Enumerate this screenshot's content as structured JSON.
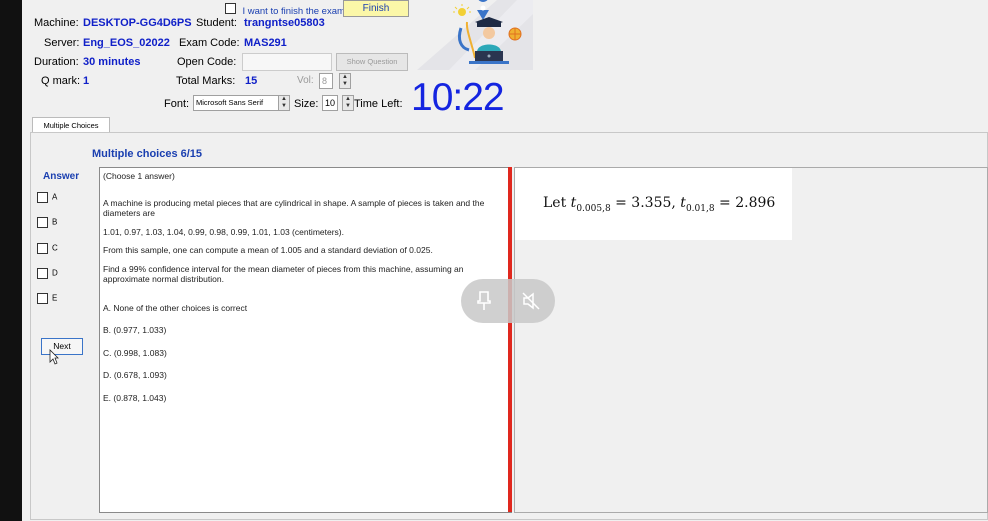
{
  "header": {
    "finish_checkbox_label": "I want to finish the exam.",
    "finish_button": "Finish",
    "machine_label": "Machine:",
    "machine_value": "DESKTOP-GG4D6PS",
    "student_label": "Student:",
    "student_value": "trangntse05803",
    "server_label": "Server:",
    "server_value": "Eng_EOS_02022",
    "exam_code_label": "Exam Code:",
    "exam_code_value": "MAS291",
    "duration_label": "Duration:",
    "duration_value": "30 minutes",
    "open_code_label": "Open Code:",
    "open_code_value": "",
    "show_question_button": "Show Question",
    "qmark_label": "Q mark:",
    "qmark_value": "1",
    "total_marks_label": "Total Marks:",
    "total_marks_value": "15",
    "vol_label": "Vol:",
    "vol_value": "8",
    "font_label": "Font:",
    "font_value": "Microsoft Sans Serif",
    "size_label": "Size:",
    "size_value": "10",
    "time_left_label": "Time Left:",
    "timer": "10:22"
  },
  "tabs": [
    "Multiple Choices"
  ],
  "question": {
    "title": "Multiple choices 6/15",
    "answer_heading": "Answer",
    "answer_options": [
      "A",
      "B",
      "C",
      "D",
      "E"
    ],
    "next_button": "Next",
    "instruction": "(Choose 1 answer)",
    "paragraphs": [
      "A machine is producing metal pieces that are cylindrical in shape. A sample of pieces is taken and the diameters are",
      "1.01, 0.97, 1.03, 1.04, 0.99, 0.98, 0.99, 1.01,  1.03 (centimeters).",
      "From this sample, one can compute a mean of 1.005 and a standard deviation of 0.025.",
      "Find a 99% confidence interval for the mean diameter of pieces from this machine, assuming an approximate normal distribution."
    ],
    "choices": [
      "A.  None of the other choices is correct",
      "B.  (0.977, 1.033)",
      "C.  (0.998, 1.083)",
      "D.  (0.678, 1.093)",
      "E.  (0.878, 1.043)"
    ],
    "formula": {
      "prefix": "Let",
      "t1_sub": "0.005,8",
      "t1_val": "= 3.355,",
      "t2_sub": "0.01,8",
      "t2_val": "= 2.896"
    }
  },
  "overlay": {
    "pin_icon": "pin-icon",
    "mute_icon": "speaker-muted-icon"
  }
}
